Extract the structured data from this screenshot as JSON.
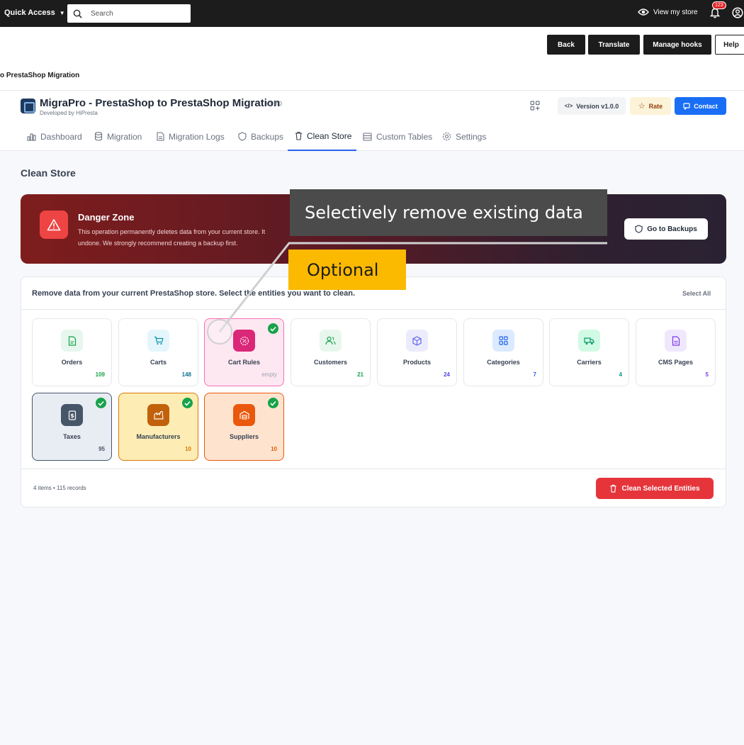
{
  "topbar": {
    "quick_access": "Quick Access",
    "search_placeholder": "Search",
    "view_store": "View my store",
    "notif_count": "123"
  },
  "header": {
    "buttons": {
      "back": "Back",
      "translate": "Translate",
      "manage_hooks": "Manage hooks",
      "help": "Help"
    },
    "breadcrumb": "o PrestaShop Migration"
  },
  "module": {
    "title": "MigraPro - PrestaShop to PrestaShop Migration",
    "version": "v1.0.0",
    "developer": "Developed by HiPresta",
    "version_btn": "Version v1.0.0",
    "rate_btn": "Rate",
    "contact_btn": "Contact"
  },
  "tabs": [
    {
      "label": "Dashboard"
    },
    {
      "label": "Migration"
    },
    {
      "label": "Migration Logs"
    },
    {
      "label": "Backups"
    },
    {
      "label": "Clean Store"
    },
    {
      "label": "Custom Tables"
    },
    {
      "label": "Settings"
    }
  ],
  "page": {
    "title": "Clean Store"
  },
  "danger": {
    "title": "Danger Zone",
    "line1": "This operation permanently deletes data from your current store. It",
    "line2": "undone. We strongly recommend creating a backup first.",
    "go_backups": "Go to Backups"
  },
  "panel": {
    "description": "Remove data from your current PrestaShop store. Select the entities you want to clean.",
    "select_all": "Select All",
    "summary": "4 items • 115 records",
    "clean_button": "Clean Selected Entities"
  },
  "entities": [
    {
      "name": "Orders",
      "count": "109",
      "selected": false
    },
    {
      "name": "Carts",
      "count": "148",
      "selected": false
    },
    {
      "name": "Cart Rules",
      "count": "empty",
      "selected": true
    },
    {
      "name": "Customers",
      "count": "21",
      "selected": false
    },
    {
      "name": "Products",
      "count": "24",
      "selected": false
    },
    {
      "name": "Categories",
      "count": "7",
      "selected": false
    },
    {
      "name": "Carriers",
      "count": "4",
      "selected": false
    },
    {
      "name": "CMS Pages",
      "count": "5",
      "selected": false
    },
    {
      "name": "Taxes",
      "count": "95",
      "selected": true
    },
    {
      "name": "Manufacturers",
      "count": "10",
      "selected": true
    },
    {
      "name": "Suppliers",
      "count": "10",
      "selected": true
    }
  ],
  "callouts": {
    "main": "Selectively remove existing data",
    "optional": "Optional"
  },
  "colors": {
    "accent": "#2563eb",
    "danger": "#e5353b",
    "check": "#16a34a",
    "callout_dark": "#4b4b4b",
    "callout_yellow": "#fbb900"
  }
}
